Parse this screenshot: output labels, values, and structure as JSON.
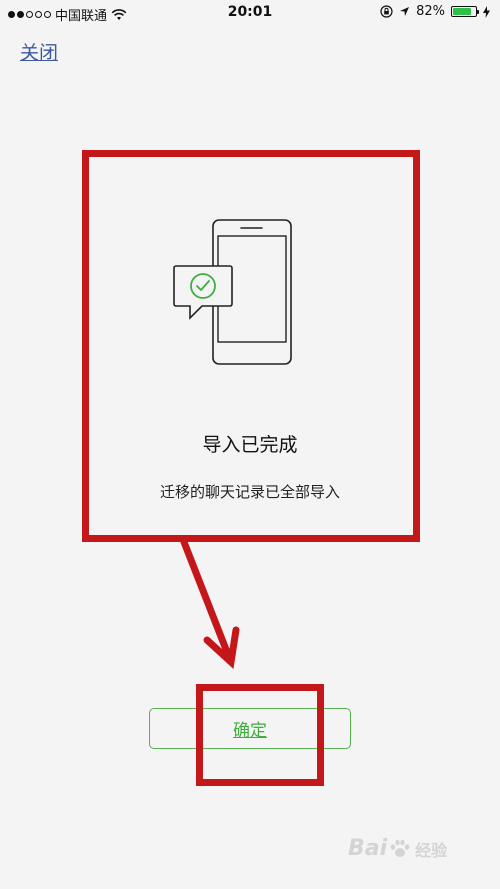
{
  "status_bar": {
    "carrier": "中国联通",
    "time": "20:01",
    "battery_percent": "82%",
    "battery_level": 0.82,
    "signal_bars": 2
  },
  "header": {
    "close_label": "关闭"
  },
  "main": {
    "title": "导入已完成",
    "description": "迁移的聊天记录已全部导入",
    "confirm_label": "确定"
  },
  "colors": {
    "accent": "#3fae3f",
    "annotation": "#c4171a",
    "link": "#3d5a9a"
  },
  "watermark": {
    "brand": "Bai",
    "brand_suffix": "经验"
  }
}
